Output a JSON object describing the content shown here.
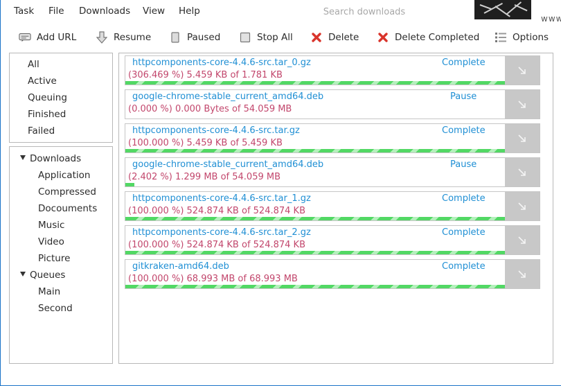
{
  "menu": [
    "Task",
    "File",
    "Downloads",
    "View",
    "Help"
  ],
  "search": {
    "placeholder": "Search downloads"
  },
  "site_fragment": "www",
  "toolbar": {
    "add_url": "Add URL",
    "resume": "Resume",
    "paused": "Paused",
    "stop_all": "Stop All",
    "delete": "Delete",
    "delete_completed": "Delete Completed",
    "options": "Options"
  },
  "categories": [
    "All",
    "Active",
    "Queuing",
    "Finished",
    "Failed"
  ],
  "tree": {
    "downloads_label": "Downloads",
    "downloads_children": [
      "Application",
      "Compressed",
      "Docouments",
      "Music",
      "Video",
      "Picture"
    ],
    "queues_label": "Queues",
    "queues_children": [
      "Main",
      "Second"
    ]
  },
  "downloads": [
    {
      "name": "httpcomponents-core-4.4.6-src.tar_0.gz",
      "status": "Complete",
      "progress": "(306.469 %) 5.459 KB of 1.781 KB",
      "fill_fraction": 1.0
    },
    {
      "name": "google-chrome-stable_current_amd64.deb",
      "status": "Pause",
      "progress": "(0.000 %) 0.000 Bytes of 54.059 MB",
      "fill_fraction": 0.0
    },
    {
      "name": "httpcomponents-core-4.4.6-src.tar.gz",
      "status": "Complete",
      "progress": "(100.000 %) 5.459 KB of 5.459 KB",
      "fill_fraction": 1.0
    },
    {
      "name": "google-chrome-stable_current_amd64.deb",
      "status": "Pause",
      "progress": "(2.402 %) 1.299 MB of 54.059 MB",
      "fill_fraction": 0.024
    },
    {
      "name": "httpcomponents-core-4.4.6-src.tar_1.gz",
      "status": "Complete",
      "progress": "(100.000 %) 524.874 KB of 524.874 KB",
      "fill_fraction": 1.0
    },
    {
      "name": "httpcomponents-core-4.4.6-src.tar_2.gz",
      "status": "Complete",
      "progress": "(100.000 %) 524.874 KB of 524.874 KB",
      "fill_fraction": 1.0
    },
    {
      "name": "gitkraken-amd64.deb",
      "status": "Complete",
      "progress": "(100.000 %) 68.993 MB of 68.993 MB",
      "fill_fraction": 1.0
    }
  ],
  "colors": {
    "link_blue": "#1f8fd4",
    "progress_text": "#c2466c",
    "progress_green": "#52d864",
    "delete_red": "#d9342b",
    "window_border": "#1a73c8"
  }
}
